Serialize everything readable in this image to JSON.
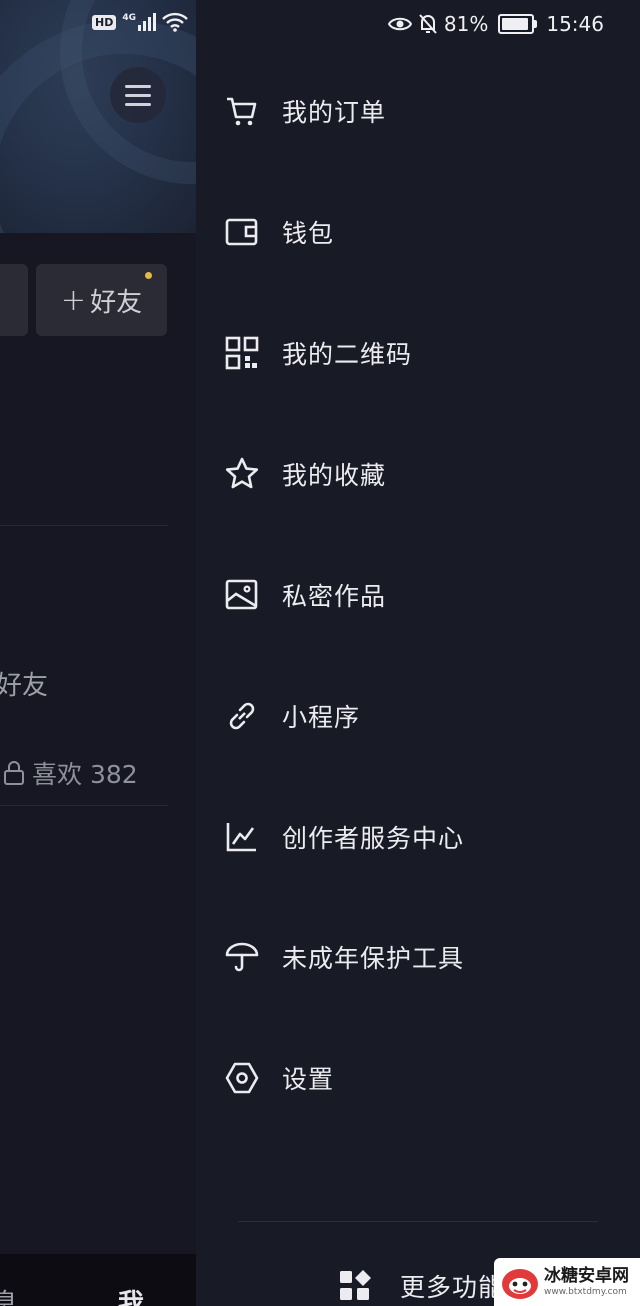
{
  "status_bar": {
    "hd": "HD",
    "network": "4G",
    "battery_percent": "81%",
    "battery_level": 0.81,
    "time": "15:46"
  },
  "background_page": {
    "add_friend_label": "好友",
    "add_friend_plus": "+",
    "fragment_1": "'",
    "fragment_2": "好友",
    "likes_label": "喜欢 382",
    "tab_partial_left": "息",
    "tab_me": "我"
  },
  "drawer": {
    "items": [
      {
        "label": "我的订单",
        "icon": "shopping-cart-icon"
      },
      {
        "label": "钱包",
        "icon": "wallet-icon"
      },
      {
        "label": "我的二维码",
        "icon": "qr-code-icon"
      },
      {
        "label": "我的收藏",
        "icon": "star-icon"
      },
      {
        "label": "私密作品",
        "icon": "image-icon"
      },
      {
        "label": "小程序",
        "icon": "link-icon"
      },
      {
        "label": "创作者服务中心",
        "icon": "chart-icon"
      },
      {
        "label": "未成年保护工具",
        "icon": "umbrella-icon"
      },
      {
        "label": "设置",
        "icon": "hexagon-settings-icon"
      }
    ],
    "more_features_label": "更多功能",
    "more_features_icon": "grid-diamond-icon"
  },
  "watermark": {
    "name": "冰糖安卓网",
    "url": "www.btxtdmy.com"
  },
  "colors": {
    "drawer_bg": "#181a26",
    "page_bg": "#161722",
    "text": "#ececf0",
    "notification_dot": "#e3b94c"
  }
}
